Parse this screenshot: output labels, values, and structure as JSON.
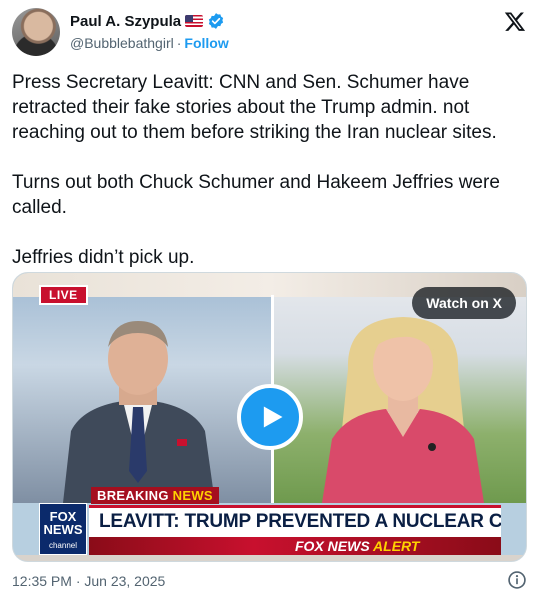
{
  "author": {
    "name": "Paul A. Szypula",
    "handle": "@Bubblebathgirl",
    "separator": "·",
    "follow_label": "Follow",
    "icons": [
      "us-flag-icon",
      "verified-badge-icon"
    ]
  },
  "platform_icon": "x-logo-icon",
  "tweet": {
    "paragraphs": [
      "Press Secretary Leavitt: CNN and Sen. Schumer have retracted their fake stories about the Trump admin. not reaching out to them before striking the Iran nuclear sites.",
      "Turns out both Chuck Schumer and Hakeem Jeffries were called.",
      "Jeffries didn’t pick up."
    ]
  },
  "media": {
    "live_label": "LIVE",
    "watch_label": "Watch on X",
    "breaking_prefix": "BREAKING ",
    "breaking_suffix": "NEWS",
    "logo_line1": "FOX",
    "logo_line2": "NEWS",
    "logo_line3": "channel",
    "headline": "LEAVITT: TRUMP PREVENTED A NUCLEAR CONFLICT",
    "alert_prefix": "FOX NEWS ",
    "alert_suffix": "ALERT",
    "play_icon": "play-icon"
  },
  "footer": {
    "timestamp": "12:35 PM · Jun 23, 2025",
    "info_icon": "info-icon"
  },
  "colors": {
    "accent": "#1d9bf0",
    "text": "#0f1419",
    "muted": "#536471",
    "fox_red": "#c8102e",
    "fox_navy": "#0a1f44"
  }
}
